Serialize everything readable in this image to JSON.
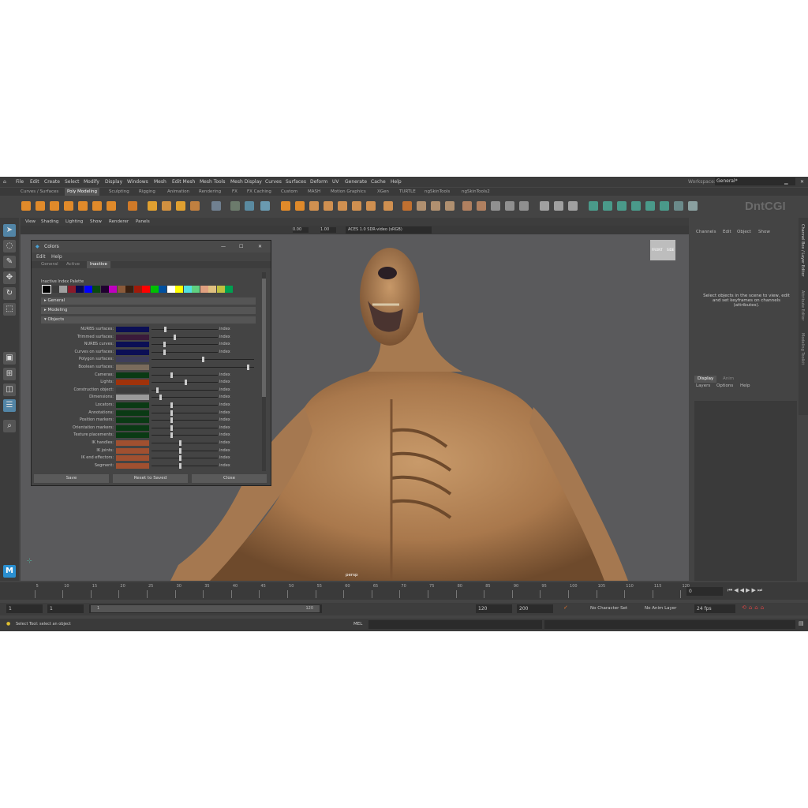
{
  "menubar": {
    "items": [
      "File",
      "Edit",
      "Create",
      "Select",
      "Modify",
      "Display",
      "Windows",
      "Mesh",
      "Edit Mesh",
      "Mesh Tools",
      "Mesh Display",
      "Curves",
      "Surfaces",
      "Deform",
      "UV",
      "Generate",
      "Cache",
      "Help"
    ],
    "workspace_label": "Workspace:",
    "workspace_value": "General*"
  },
  "shelf_tabs": [
    "Curves / Surfaces",
    "Poly Modeling",
    "Sculpting",
    "Rigging",
    "Animation",
    "Rendering",
    "FX",
    "FX Caching",
    "Custom",
    "MASH",
    "Motion Graphics",
    "XGen",
    "TURTLE",
    "ngSkinTools",
    "ngSkinTools2"
  ],
  "shelf_active": "Poly Modeling",
  "viewport": {
    "menu": [
      "View",
      "Shading",
      "Lighting",
      "Show",
      "Renderer",
      "Panels"
    ],
    "val1": "0.00",
    "val2": "1.00",
    "colorspace": "ACES 1.0 SDR-video (sRGB)",
    "camera": "persp",
    "cube_front": "FRONT",
    "cube_side": "SIDE"
  },
  "dialog": {
    "title": "Colors",
    "menus": [
      "Edit",
      "Help"
    ],
    "tabs": [
      "General",
      "Active",
      "Inactive"
    ],
    "active_tab": "Inactive",
    "palette_label": "Inactive Index Palette",
    "sections": [
      "General",
      "Modeling",
      "Objects"
    ],
    "rows": [
      {
        "label": "NURBS surfaces:",
        "color": "#0b0f55",
        "knob": 0.2,
        "idx": "index"
      },
      {
        "label": "Trimmed surfaces:",
        "color": "#3a1a3a",
        "knob": 0.35,
        "idx": "index"
      },
      {
        "label": "NURBS curves:",
        "color": "#0b0f55",
        "knob": 0.18,
        "idx": "index"
      },
      {
        "label": "Curves on surfaces:",
        "color": "#0b0f55",
        "knob": 0.18,
        "idx": "index"
      },
      {
        "label": "Polygon surfaces:",
        "color": "#3e3e5a",
        "knob": 0.5,
        "idx": ""
      },
      {
        "label": "Boolean surfaces:",
        "color": "#7a6c5c",
        "knob": 0.95,
        "idx": ""
      },
      {
        "label": "Cameras:",
        "color": "#0a3a14",
        "knob": 0.3,
        "idx": "index"
      },
      {
        "label": "Lights:",
        "color": "#a0320a",
        "knob": 0.52,
        "idx": "index"
      },
      {
        "label": "Construction object:",
        "color": "#3c3c3c",
        "knob": 0.08,
        "idx": "index"
      },
      {
        "label": "Dimensions:",
        "color": "#9a9a9a",
        "knob": 0.12,
        "idx": "index"
      },
      {
        "label": "Locators:",
        "color": "#0a3a14",
        "knob": 0.3,
        "idx": "index"
      },
      {
        "label": "Annotations:",
        "color": "#0a3a14",
        "knob": 0.3,
        "idx": "index"
      },
      {
        "label": "Position markers:",
        "color": "#0a3a14",
        "knob": 0.3,
        "idx": "index"
      },
      {
        "label": "Orientation markers:",
        "color": "#0a3a14",
        "knob": 0.3,
        "idx": "index"
      },
      {
        "label": "Texture placements:",
        "color": "#0a3a14",
        "knob": 0.3,
        "idx": "index"
      },
      {
        "label": "IK handles:",
        "color": "#a05030",
        "knob": 0.43,
        "idx": "index"
      },
      {
        "label": "IK joints:",
        "color": "#a05030",
        "knob": 0.43,
        "idx": "index"
      },
      {
        "label": "IK end effectors:",
        "color": "#a05030",
        "knob": 0.43,
        "idx": "index"
      },
      {
        "label": "Segment:",
        "color": "#a05030",
        "knob": 0.43,
        "idx": "index"
      }
    ],
    "buttons": {
      "save": "Save",
      "reset": "Reset to Saved",
      "close": "Close"
    }
  },
  "channelbox": {
    "menus": [
      "Channels",
      "Edit",
      "Object",
      "Show"
    ],
    "message": "Select objects in the scene to view, edit and set keyframes on channels (attributes)."
  },
  "layers": {
    "tabs": [
      "Display",
      "Anim"
    ],
    "menus": [
      "Layers",
      "Options",
      "Help"
    ]
  },
  "side_tabs": [
    "Channel Box / Layer Editor",
    "Attribute Editor",
    "Modeling Toolkit"
  ],
  "timeline": {
    "ticks": [
      "5",
      "10",
      "15",
      "20",
      "25",
      "30",
      "35",
      "40",
      "45",
      "50",
      "55",
      "60",
      "65",
      "70",
      "75",
      "80",
      "85",
      "90",
      "95",
      "100",
      "105",
      "110",
      "115",
      "120"
    ],
    "current_frame": "0"
  },
  "range": {
    "start": "1",
    "start2": "1",
    "slider_start": "1",
    "slider_end": "120",
    "end": "120",
    "end2": "200",
    "char_set": "No Character Set",
    "anim_layer": "No Anim Layer",
    "fps": "24 fps"
  },
  "cmd": {
    "status": "Select Tool: select an object",
    "mel": "MEL"
  },
  "watermark": "DntCGI"
}
